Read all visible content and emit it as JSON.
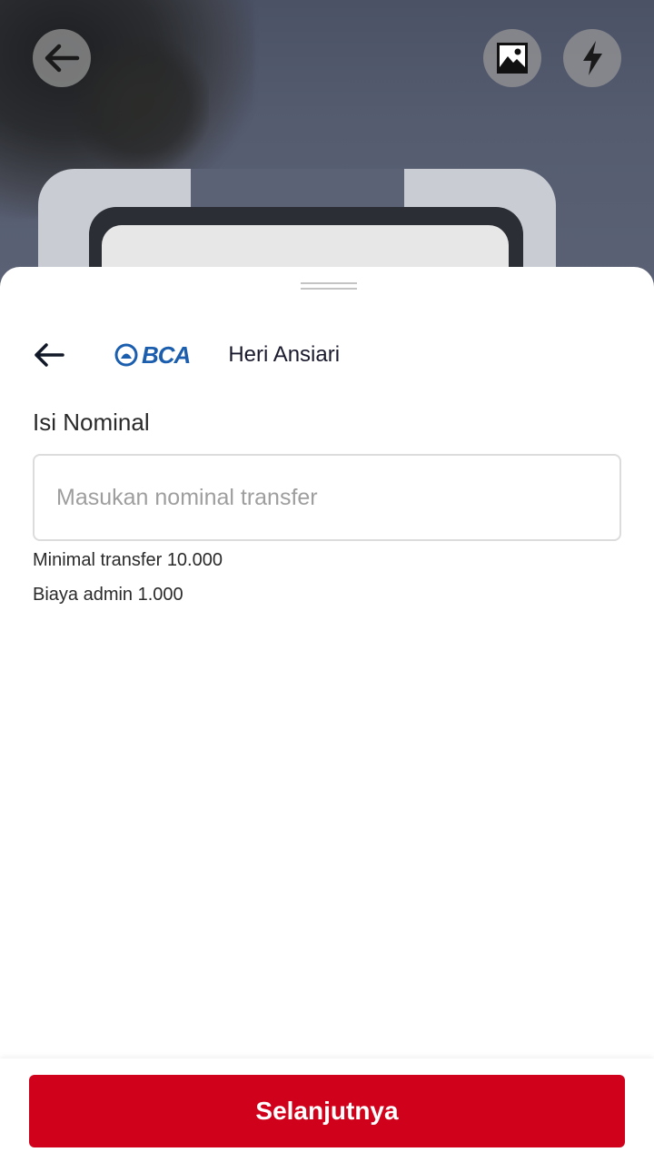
{
  "camera": {
    "back_icon": "arrow-left-icon",
    "gallery_icon": "image-icon",
    "flash_icon": "flash-icon"
  },
  "sheet": {
    "back_icon": "arrow-left-icon",
    "bank": {
      "logo_text": "BCA",
      "logo_color": "#1b5eae"
    },
    "account_name": "Heri Ansiari",
    "nominal_label": "Isi Nominal",
    "nominal_input": {
      "value": "",
      "placeholder": "Masukan nominal transfer"
    },
    "min_transfer": "Minimal transfer 10.000",
    "admin_fee": "Biaya admin 1.000"
  },
  "footer": {
    "next_label": "Selanjutnya",
    "accent_color": "#d0021b"
  }
}
